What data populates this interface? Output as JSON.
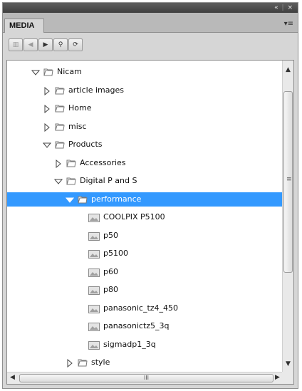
{
  "window": {
    "collapse_label": "«",
    "close_label": "×"
  },
  "tab": {
    "label": "MEDIA"
  },
  "panel_menu_label": "▾≡",
  "toolbar": {
    "buttons": [
      {
        "name": "page-icon",
        "glyph": "▥",
        "disabled": true
      },
      {
        "name": "back-icon",
        "glyph": "◀",
        "disabled": true
      },
      {
        "name": "forward-icon",
        "glyph": "▶",
        "disabled": false
      },
      {
        "name": "search-icon",
        "glyph": "⚲",
        "disabled": false
      },
      {
        "name": "refresh-icon",
        "glyph": "⟳",
        "disabled": false
      }
    ]
  },
  "tree": {
    "rows": [
      {
        "label": "Nicam",
        "type": "folder",
        "state": "open",
        "depth": 1
      },
      {
        "label": "article images",
        "type": "folder",
        "state": "closed",
        "depth": 2
      },
      {
        "label": "Home",
        "type": "folder",
        "state": "closed",
        "depth": 2
      },
      {
        "label": "misc",
        "type": "folder",
        "state": "closed",
        "depth": 2
      },
      {
        "label": "Products",
        "type": "folder",
        "state": "open",
        "depth": 2
      },
      {
        "label": "Accessories",
        "type": "folder",
        "state": "closed",
        "depth": 3
      },
      {
        "label": "Digital P and S",
        "type": "folder",
        "state": "open",
        "depth": 3
      },
      {
        "label": "performance",
        "type": "folder",
        "state": "open",
        "depth": 4,
        "selected": true
      },
      {
        "label": "COOLPIX P5100",
        "type": "image",
        "depth": 5
      },
      {
        "label": "p50",
        "type": "image",
        "depth": 5
      },
      {
        "label": "p5100",
        "type": "image",
        "depth": 5
      },
      {
        "label": "p60",
        "type": "image",
        "depth": 5
      },
      {
        "label": "p80",
        "type": "image",
        "depth": 5
      },
      {
        "label": "panasonic_tz4_450",
        "type": "image",
        "depth": 5
      },
      {
        "label": "panasonictz5_3q",
        "type": "image",
        "depth": 5
      },
      {
        "label": "sigmadp1_3q",
        "type": "image",
        "depth": 5
      },
      {
        "label": "style",
        "type": "folder",
        "state": "closed",
        "depth": 4
      }
    ]
  },
  "scrollbars": {
    "vertical_grip": "≡",
    "horizontal_grip": "III"
  },
  "colors": {
    "selection": "#3399ff",
    "panel_bg": "#d6d6d6",
    "titlebar": "#4a4a4a"
  }
}
